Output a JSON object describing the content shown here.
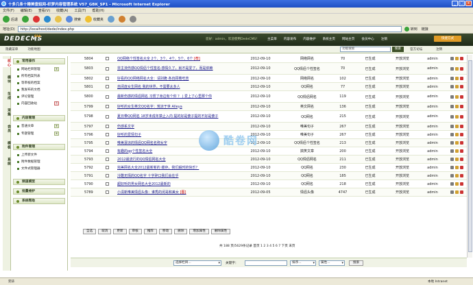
{
  "window": {
    "title": "十多几条十睡美查姐网-织梦内容管理系统 V57_GBK_SP1 - Microsoft Internet Explorer"
  },
  "ie_menu": [
    "文件(F)",
    "编辑(E)",
    "查看(V)",
    "收藏(A)",
    "工具(T)",
    "帮助(H)"
  ],
  "ie_toolbar": {
    "back": "后退",
    "search": "搜索",
    "favorites": "收藏夹"
  },
  "address": {
    "label": "地址(D)",
    "url": "http://localhost/dede/index.php",
    "go": "转到",
    "links": "链接"
  },
  "header": {
    "logo": "DEDECMS",
    "version": "5.7",
    "version_badge": "Gbk",
    "userinfo": "您好：admin，欢迎使用DedeCMS！",
    "nav": [
      "主菜单",
      "内容发布",
      "内容维护",
      "系统主页",
      "网站主页",
      "会员中心",
      "注销"
    ],
    "quick": "快捷方式"
  },
  "subbar": {
    "left_links": [
      "隐藏菜单",
      "功能地图"
    ],
    "search_placeholder": "功能搜索",
    "search_btn": "搜索",
    "site_link": "官方论坛",
    "logout": "注销"
  },
  "side_tabs": [
    "核心",
    "模块",
    "生成",
    "采集",
    "会员",
    "模板",
    "系统"
  ],
  "sidebar": {
    "sections": [
      {
        "title": "常用操作",
        "items": [
          "网站栏目管理",
          "所有档案列表",
          "等审核的档案",
          "我发布的文档",
          "评论管理",
          "内容回收站"
        ]
      },
      {
        "title": "内容管理",
        "items": [
          "普通文章",
          "专题管理"
        ]
      },
      {
        "title": "附件管理",
        "items": [
          "上传新文件",
          "附件数据管理",
          "文件式管理器"
        ]
      },
      {
        "title": "频道模型",
        "items": []
      },
      {
        "title": "批量维护",
        "items": []
      },
      {
        "title": "系统帮助",
        "items": []
      }
    ]
  },
  "rows": [
    {
      "id": "5804",
      "title": "QQ网络个性签名大全 2个、3个、4个、5个、6个",
      "tag": "[荐]",
      "date": "2012-09-10",
      "cat": "网络网名",
      "hits": "70",
      "status": "已生成",
      "perm": "开放浏览",
      "author": "admin"
    },
    {
      "id": "5803",
      "title": "非主流伤感QQ情侣个性签名:感情久了，就不是爱了，而是依赖",
      "tag": "",
      "date": "2012-09-10",
      "cat": "QQ情侣个性签名",
      "hits": "70",
      "status": "已生成",
      "perm": "开放浏览",
      "author": "admin"
    },
    {
      "id": "5802",
      "title": "好看的QQ网络网名大全：请别跪 各自顾着吃苦",
      "tag": "",
      "date": "2012-09-10",
      "cat": "网络网名",
      "hits": "102",
      "status": "已生成",
      "perm": "开放浏览",
      "author": "admin"
    },
    {
      "id": "5801",
      "title": "自闭症女生网名 我的世界，不需要太多人",
      "tag": "",
      "date": "2012-09-10",
      "cat": "QQ网名",
      "hits": "77",
      "status": "已生成",
      "perm": "开放浏览",
      "author": "admin"
    },
    {
      "id": "5800",
      "title": "最新伤感的情侣网名 习惯了身边有个你 ？ | 爱上了心里那个你",
      "tag": "",
      "date": "2012-09-10",
      "cat": "QQ情侣网名",
      "hits": "119",
      "status": "已生成",
      "perm": "开放浏览",
      "author": "admin"
    },
    {
      "id": "5799",
      "title": "好听的女生英文QQ名字：荒凉于世 Alleya",
      "tag": "",
      "date": "2012-09-10",
      "cat": "英文网名",
      "hits": "136",
      "status": "已生成",
      "perm": "开放浏览",
      "author": "admin"
    },
    {
      "id": "5798",
      "title": "夏日带QQ网名 18岁未成年禁止入内 提的好是傻子提的不好是傻子",
      "tag": "",
      "date": "2012-09-10",
      "cat": "QQ网名",
      "hits": "215",
      "status": "已生成",
      "perm": "开放浏览",
      "author": "admin"
    },
    {
      "id": "5797",
      "title": "伤感系文字",
      "tag": "",
      "date": "2012-09-10",
      "cat": "唯美句子",
      "hits": "267",
      "status": "已生成",
      "perm": "开放浏览",
      "author": "admin"
    },
    {
      "id": "5796",
      "title": "好听的爱情句子",
      "tag": "",
      "date": "2012-09-10",
      "cat": "唯美句子",
      "hits": "267",
      "status": "已生成",
      "perm": "开放浏览",
      "author": "admin"
    },
    {
      "id": "5795",
      "title": "唯美凄凉的情侣QQ网名名称女字",
      "tag": "",
      "date": "2012-09-10",
      "cat": "QQ情侣个性签名",
      "hits": "213",
      "status": "已生成",
      "perm": "开放浏览",
      "author": "admin"
    },
    {
      "id": "5794",
      "title": "有趣的qq个性签名大全",
      "tag": "",
      "date": "2012-09-10",
      "cat": "搞笑文章",
      "hits": "200",
      "status": "已生成",
      "perm": "开放浏览",
      "author": "admin"
    },
    {
      "id": "5793",
      "title": "2012最流行的QQ情侣网名大全",
      "tag": "",
      "date": "2012-09-10",
      "cat": "QQ情侣网名",
      "hits": "211",
      "status": "已生成",
      "perm": "开放浏览",
      "author": "admin"
    },
    {
      "id": "5792",
      "title": "完美网名大全2012最新新的 缓存，我们解时的快乐？",
      "tag": "",
      "date": "2012-09-10",
      "cat": "QQ网名",
      "hits": "230",
      "status": "已生成",
      "perm": "开放浏览",
      "author": "admin"
    },
    {
      "id": "5791",
      "title": "冷酷无情的QQ名字 十字碎口我们会在乎",
      "tag": "",
      "date": "2012-09-10",
      "cat": "QQ网名",
      "hits": "185",
      "status": "已生成",
      "perm": "开放浏览",
      "author": "admin"
    },
    {
      "id": "5790",
      "title": "超好听的男女网名大全2012最新的",
      "tag": "",
      "date": "2012-09-10",
      "cat": "QQ网名",
      "hits": "218",
      "status": "已生成",
      "perm": "开放浏览",
      "author": "admin"
    },
    {
      "id": "5789",
      "title": "小清新唯美情侣头像：谁秀的闲哥和美女",
      "tag": "[图]",
      "date": "2012-09-05",
      "cat": "情侣头像",
      "hits": "4747",
      "status": "已生成",
      "perm": "开放浏览",
      "author": "admin"
    }
  ],
  "actions": [
    "全选",
    "取消",
    "更新",
    "审核",
    "推荐",
    "移动",
    "删除",
    "增加属性",
    "删除属性"
  ],
  "pager": "共 188 页/5629条记录 首页 1 2 3 4 5 6 7 下页 末页",
  "filter": {
    "category": "选择栏目...",
    "keyword_label": "关键字：",
    "sort": "排序...",
    "attr": "属性...",
    "search_btn": "搜索"
  },
  "status": {
    "left": "完毕",
    "right": "本地 Intranet"
  },
  "watermark": "酷卷网"
}
